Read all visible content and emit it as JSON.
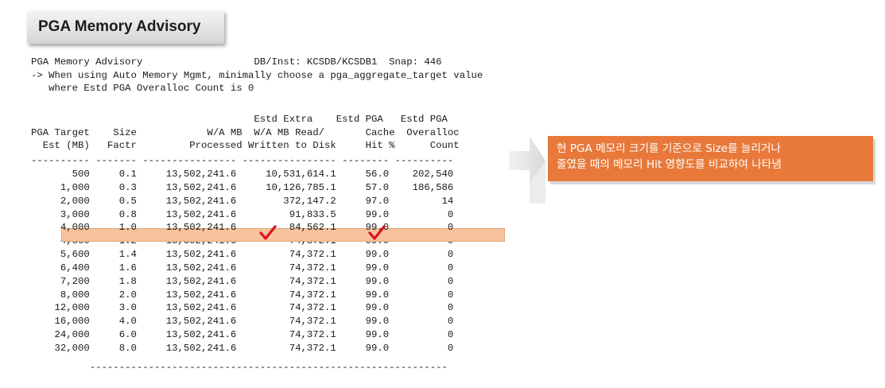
{
  "title": "PGA Memory Advisory",
  "report": {
    "lines": [
      "PGA Memory Advisory                   DB/Inst: KCSDB/KCSDB1  Snap: 446",
      "-> When using Auto Memory Mgmt, minimally choose a pga_aggregate_target value",
      "   where Estd PGA Overalloc Count is 0",
      "",
      "                                      Estd Extra    Estd PGA   Estd PGA",
      "PGA Target    Size            W/A MB  W/A MB Read/       Cache  Overalloc",
      "  Est (MB)   Factr         Processed Written to Disk     Hit %      Count",
      "---------- ------- ---------------- ---------------- -------- ----------",
      "       500     0.1     13,502,241.6     10,531,614.1     56.0    202,540",
      "     1,000     0.3     13,502,241.6     10,126,785.1     57.0    186,586",
      "     2,000     0.5     13,502,241.6        372,147.2     97.0         14",
      "     3,000     0.8     13,502,241.6         91,833.5     99.0          0",
      "     4,000     1.0     13,502,241.6         84,562.1     99.0          0",
      "     4,800     1.2     13,502,241.6         74,372.1     99.0          0",
      "     5,600     1.4     13,502,241.6         74,372.1     99.0          0",
      "     6,400     1.6     13,502,241.6         74,372.1     99.0          0",
      "     7,200     1.8     13,502,241.6         74,372.1     99.0          0",
      "     8,000     2.0     13,502,241.6         74,372.1     99.0          0",
      "    12,000     3.0     13,502,241.6         74,372.1     99.0          0",
      "    16,000     4.0     13,502,241.6         74,372.1     99.0          0",
      "    24,000     6.0     13,502,241.6         74,372.1     99.0          0",
      "    32,000     8.0     13,502,241.6         74,372.1     99.0          0",
      "          -------------------------------------------------------------"
    ],
    "highlighted_row": 12
  },
  "note": {
    "line1": "현 PGA 메모리 크기를 기준으로 Size를 늘리거나",
    "line2": "줄였을 때의 메모리 Hit 영향도를 비교하여 나타냄"
  },
  "colors": {
    "highlight": "#f6c39c",
    "note_bg": "#e8793a",
    "check": "#e0101a"
  },
  "icons": [
    "checkmark-icon",
    "arrow-right-icon"
  ]
}
